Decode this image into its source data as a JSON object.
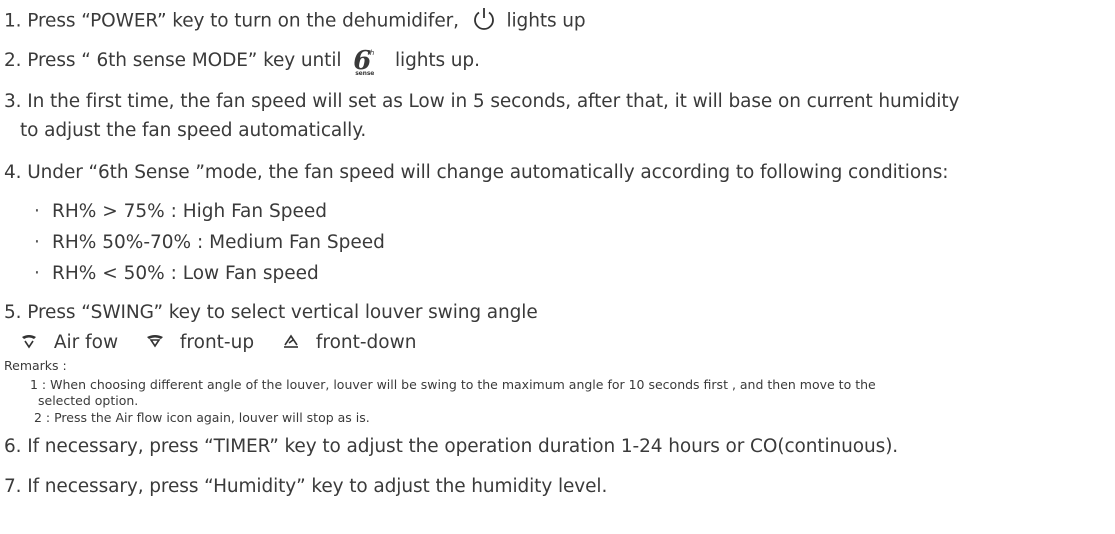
{
  "steps": {
    "s1_a": "1. Press “POWER” key to turn on the dehumidifer,",
    "s1_b": "lights up",
    "s2_a": "2. Press “ 6th sense  MODE” key until",
    "s2_icon_num": "6",
    "s2_icon_sup": "th",
    "s2_icon_sub": "sense",
    "s2_b": "lights up.",
    "s3_a": "3. In the first time, the fan speed will set as Low in 5 seconds, after that, it will base on current humidity",
    "s3_b": "to adjust the fan speed automatically.",
    "s4": "4. Under “6th Sense ”mode, the fan speed will change automatically according to following conditions:",
    "bullet_char": "·",
    "bullets": [
      "RH% > 75% : High Fan Speed",
      "RH% 50%-70% : Medium Fan Speed",
      "RH% < 50% : Low Fan speed"
    ],
    "s5": "5. Press “SWING” key to select vertical louver swing angle",
    "swing": [
      "Air fow",
      "front-up",
      "front-down"
    ],
    "remarks_title": "Remarks :",
    "remark1_a": "1 : When choosing different angle of the louver, louver will be swing to the maximum  angle for 10 seconds first ,  and then move  to the",
    "remark1_b": "selected option.",
    "remark2": "2 : Press the Air flow icon again, louver will stop as is.",
    "s6": "6. If necessary, press “TIMER” key to adjust the operation duration 1-24 hours or CO(continuous).",
    "s7": "7. If necessary, press “Humidity” key to adjust the humidity level."
  },
  "icons": [
    "power-icon",
    "sixth-sense-icon",
    "airflow-swing-icon",
    "front-up-icon",
    "front-down-icon"
  ]
}
